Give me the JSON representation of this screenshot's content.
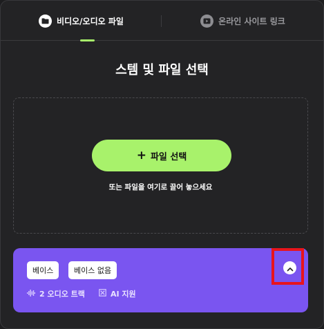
{
  "tabs": {
    "file_label": "비디오/오디오 파일",
    "online_label": "온라인 사이트 링크"
  },
  "title": "스템 및 파일 선택",
  "dropzone": {
    "button_label": "파일 선택",
    "hint": "또는 파일을 여기로 끌어 놓으세요"
  },
  "stem_card": {
    "chips": [
      "베이스",
      "베이스 없음"
    ],
    "tracks_label": "2 오디오 트랙",
    "ai_label": "AI 지원"
  },
  "colors": {
    "accent": "#a8f26b",
    "card": "#7a55f0",
    "highlight": "#e8141c",
    "background": "#232325"
  },
  "icons": {
    "file_tab": "folder-icon",
    "online_tab": "play-icon",
    "button": "plus-icon",
    "tracks": "waveform-icon",
    "ai": "ai-icon",
    "collapse": "chevron-up-icon"
  }
}
